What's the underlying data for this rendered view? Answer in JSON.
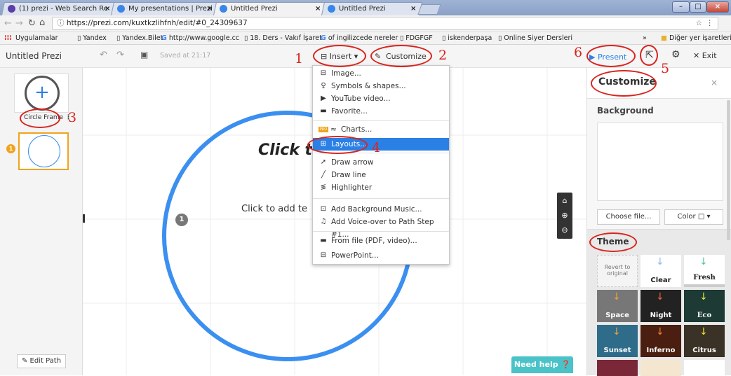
{
  "browser": {
    "tabs": [
      {
        "title": "(1) prezi - Web Search Re"
      },
      {
        "title": "My presentations | Prezi"
      },
      {
        "title": "Untitled Prezi"
      },
      {
        "title": "Untitled Prezi"
      }
    ],
    "url": "https://prezi.com/kuxtkzlihfnh/edit/#0_24309637",
    "bookmarks": [
      "Uygulamalar",
      "Yandex",
      "Yandex.Bilet",
      "http://www.google.cc",
      "18. Ders - Vakıf İşaret",
      "of ingilizcede nereler",
      "FDGFGF",
      "iskenderpaşa",
      "Online Siyer Dersleri"
    ],
    "other_bookmarks": "Diğer yer işaretleri",
    "overflow": "»"
  },
  "toolbar": {
    "title": "Untitled Prezi",
    "saved": "Saved at 21:17",
    "insert_label": "Insert",
    "customize_label": "Customize",
    "present_label": "Present",
    "exit_label": "Exit"
  },
  "left_panel": {
    "frame_label": "Circle Frame",
    "step_number": "1",
    "edit_path_label": "Edit Path"
  },
  "canvas": {
    "title_placeholder": "Click t",
    "body_placeholder": "Click to add te",
    "step_marker": "1",
    "need_help_label": "Need help"
  },
  "insert_menu": {
    "items": [
      {
        "icon": "image-icon",
        "label": "Image..."
      },
      {
        "icon": "symbols-icon",
        "label": "Symbols & shapes..."
      },
      {
        "icon": "youtube-icon",
        "label": "YouTube video..."
      },
      {
        "icon": "favorite-icon",
        "label": "Favorite..."
      },
      {
        "icon": "charts-icon",
        "label": "Charts...",
        "badge": "PRO"
      },
      {
        "icon": "layouts-icon",
        "label": "Layouts..."
      },
      {
        "icon": "arrow-icon",
        "label": "Draw arrow"
      },
      {
        "icon": "line-icon",
        "label": "Draw line"
      },
      {
        "icon": "highlighter-icon",
        "label": "Highlighter"
      },
      {
        "icon": "music-icon",
        "label": "Add Background Music..."
      },
      {
        "icon": "voiceover-icon",
        "label": "Add Voice-over to Path Step #1..."
      },
      {
        "icon": "file-icon",
        "label": "From file (PDF, video)..."
      },
      {
        "icon": "powerpoint-icon",
        "label": "PowerPoint..."
      }
    ]
  },
  "customize_panel": {
    "title": "Customize",
    "background_label": "Background",
    "choose_file_label": "Choose file...",
    "color_label": "Color",
    "theme_label": "Theme",
    "themes": [
      {
        "name": "Revert to original"
      },
      {
        "name": "Clear"
      },
      {
        "name": "Fresh"
      },
      {
        "name": "Space"
      },
      {
        "name": "Night"
      },
      {
        "name": "Eco"
      },
      {
        "name": "Sunset"
      },
      {
        "name": "Inferno"
      },
      {
        "name": "Citrus"
      }
    ]
  },
  "annotations": {
    "numbers": [
      "1",
      "2",
      "3",
      "4",
      "5",
      "6"
    ]
  },
  "colors": {
    "annotation": "#d9231d",
    "accent_blue": "#2b80e5",
    "frame_circle": "#3b8ff0",
    "need_help": "#4ac3c8"
  }
}
